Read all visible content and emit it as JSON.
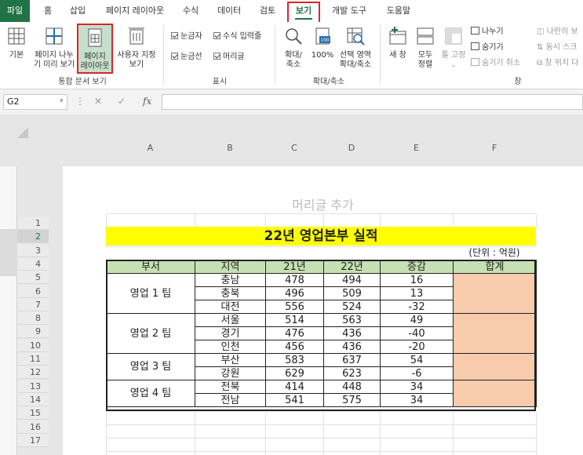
{
  "ribbon_tabs": [
    "파일",
    "홈",
    "삽입",
    "페이지 레이아웃",
    "수식",
    "데이터",
    "검토",
    "보기",
    "개발 도구",
    "도움말"
  ],
  "active_tab": "보기",
  "groups": {
    "workbook_views": {
      "label": "통합 문서 보기",
      "normal": "기본",
      "page_break_1": "페이지 나누",
      "page_break_2": "기 미리 보기",
      "page_layout_1": "페이지",
      "page_layout_2": "레이아웃",
      "custom_1": "사용자 지정",
      "custom_2": "보기"
    },
    "show": {
      "label": "표시",
      "ruler": "눈금자",
      "formula_bar": "수식 입력줄",
      "gridlines": "눈금선",
      "headings": "머리글"
    },
    "zoom": {
      "label": "확대/축소",
      "zoom_1": "확대/",
      "zoom_2": "축소",
      "zoom_100": "100%",
      "zoom_sel_1": "선택 영역",
      "zoom_sel_2": "확대/축소"
    },
    "window": {
      "label": "창",
      "new_window": "새 창",
      "arrange_1": "모두",
      "arrange_2": "정렬",
      "freeze": "틀 고정",
      "split": "나누기",
      "hide": "숨기기",
      "unhide": "숨기기 취소",
      "side_by_side": "나란히 보",
      "sync_scroll": "동시 스크",
      "reset_pos": "창 위치 다"
    }
  },
  "name_box": "G2",
  "fx_label": "fx",
  "columns": [
    "A",
    "B",
    "C",
    "D",
    "E",
    "F"
  ],
  "rows": [
    "1",
    "2",
    "3",
    "4",
    "5",
    "6",
    "7",
    "8",
    "9",
    "10",
    "11",
    "12",
    "13",
    "14",
    "15",
    "16",
    "17"
  ],
  "selected_row": "2",
  "page_header_placeholder": "머리글 추가",
  "sheet": {
    "title": "22년 영업본부 실적",
    "unit": "(단위 : 억원)",
    "headers": [
      "부서",
      "지역",
      "21년",
      "22년",
      "증감",
      "합계"
    ],
    "teams": [
      {
        "name": "영업 1 팀",
        "rows": [
          [
            "충남",
            "478",
            "494",
            "16"
          ],
          [
            "충북",
            "496",
            "509",
            "13"
          ],
          [
            "대전",
            "556",
            "524",
            "-32"
          ]
        ]
      },
      {
        "name": "영업 2 팀",
        "rows": [
          [
            "서울",
            "514",
            "563",
            "49"
          ],
          [
            "경기",
            "476",
            "436",
            "-40"
          ],
          [
            "인천",
            "456",
            "436",
            "-20"
          ]
        ]
      },
      {
        "name": "영업 3 팀",
        "rows": [
          [
            "부산",
            "583",
            "637",
            "54"
          ],
          [
            "강원",
            "629",
            "623",
            "-6"
          ]
        ]
      },
      {
        "name": "영업 4 팀",
        "rows": [
          [
            "전북",
            "414",
            "448",
            "34"
          ],
          [
            "전남",
            "541",
            "575",
            "34"
          ]
        ]
      }
    ]
  },
  "colors": {
    "accent": "#217346",
    "highlight": "#d9262c",
    "title_fill": "#ffff00",
    "header_fill": "#c6e0b4",
    "sum_fill": "#f8cbad"
  }
}
